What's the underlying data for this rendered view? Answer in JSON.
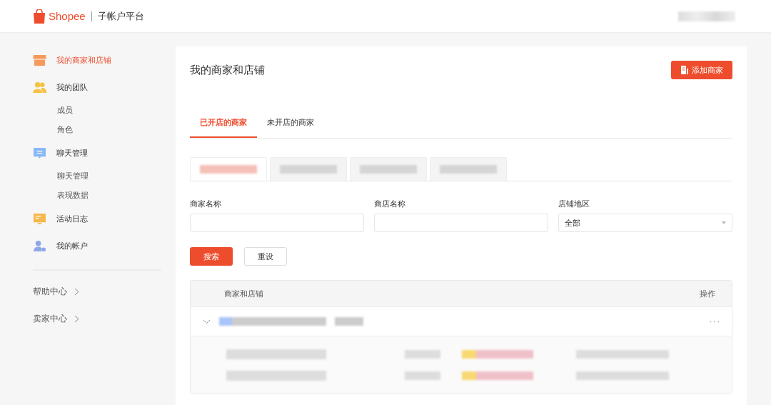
{
  "header": {
    "brand": "Shopee",
    "platform": "子帐户平台"
  },
  "sidebar": {
    "items": [
      {
        "label": "我的商家和店铺",
        "kind": "store",
        "selected": true
      },
      {
        "label": "我的团队",
        "kind": "team",
        "selected": false,
        "children": [
          {
            "label": "成员",
            "selected": false
          },
          {
            "label": "角色",
            "selected": false
          }
        ]
      },
      {
        "label": "聊天管理",
        "kind": "chat",
        "selected": false,
        "children": [
          {
            "label": "聊天管理",
            "selected": false
          },
          {
            "label": "表现数据",
            "selected": false
          }
        ]
      },
      {
        "label": "活动日志",
        "kind": "log",
        "selected": false
      },
      {
        "label": "我的帐户",
        "kind": "account",
        "selected": false
      }
    ],
    "links": [
      {
        "label": "帮助中心"
      },
      {
        "label": "卖家中心"
      }
    ]
  },
  "page": {
    "title": "我的商家和店铺",
    "add_button": "添加商家"
  },
  "tabs": [
    {
      "label": "已开店的商家",
      "selected": true
    },
    {
      "label": "未开店的商家",
      "selected": false
    }
  ],
  "region_tabs": [
    {
      "selected": true
    },
    {
      "selected": false
    },
    {
      "selected": false
    },
    {
      "selected": false
    }
  ],
  "filters": [
    {
      "label": "商家名称",
      "kind": "text"
    },
    {
      "label": "商店名称",
      "kind": "text"
    },
    {
      "label": "店铺地区",
      "kind": "select",
      "value": "全部"
    }
  ],
  "buttons": {
    "search": "搜索",
    "reset": "重设"
  },
  "table": {
    "columns": [
      "商家和店铺",
      "操作"
    ],
    "rows": [
      {
        "expanded": true,
        "children": [
          {
            "kind": "shop"
          },
          {
            "kind": "shop"
          }
        ]
      }
    ]
  }
}
